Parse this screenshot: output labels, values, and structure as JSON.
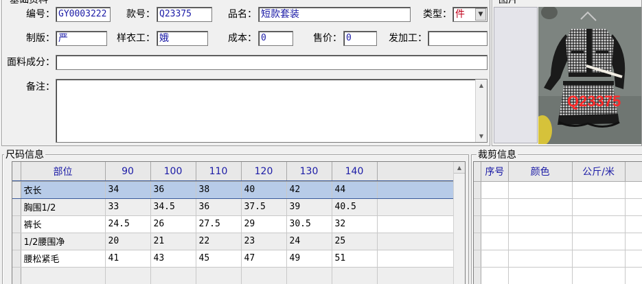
{
  "basic_info": {
    "title": "基础资料",
    "code_label": "编号：",
    "code_value": "GY0003222",
    "style_label": "款号：",
    "style_value": "Q23375",
    "name_label": "品名：",
    "name_value": "短款套装",
    "type_label": "类型：",
    "type_value": "件",
    "pattern_label": "制版：",
    "pattern_value": "严",
    "sample_label": "样衣工：",
    "sample_value": "娥",
    "cost_label": "成本：",
    "cost_value": "0",
    "price_label": "售价：",
    "price_value": "0",
    "processor_label": "发加工：",
    "processor_value": "",
    "fabric_label": "面料成分：",
    "fabric_value": "",
    "remark_label": "备注：",
    "remark_value": ""
  },
  "picture": {
    "title": "图片",
    "watermark": "Q23375"
  },
  "size_info": {
    "title": "尺码信息",
    "columns": [
      "部位",
      "90",
      "100",
      "110",
      "120",
      "130",
      "140"
    ],
    "rows": [
      [
        "衣长",
        "34",
        "36",
        "38",
        "40",
        "42",
        "44"
      ],
      [
        "胸围1/2",
        "33",
        "34.5",
        "36",
        "37.5",
        "39",
        "40.5"
      ],
      [
        "裤长",
        "24.5",
        "26",
        "27.5",
        "29",
        "30.5",
        "32"
      ],
      [
        "1/2腰围净",
        "20",
        "21",
        "22",
        "23",
        "24",
        "25"
      ],
      [
        "腰松紧毛",
        "41",
        "43",
        "45",
        "47",
        "49",
        "51"
      ]
    ],
    "selected_row": 0
  },
  "cut_info": {
    "title": "裁剪信息",
    "columns": [
      "序号",
      "颜色",
      "公斤/米"
    ]
  },
  "colors": {
    "selected_row": "#b7cbe8",
    "header_text": "#1a1aa6",
    "field_text": "#1a1aa6",
    "type_text": "#c0001a"
  }
}
